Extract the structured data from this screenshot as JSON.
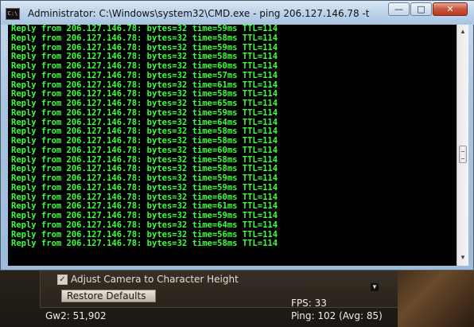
{
  "window": {
    "title": "Administrator: C:\\Windows\\system32\\CMD.exe - ping  206.127.146.78 -t",
    "icon_label": "C:\\",
    "minimize_label": "—",
    "maximize_label": "□",
    "close_label": "✕"
  },
  "console": {
    "lines": [
      "Reply from 206.127.146.78: bytes=32 time=59ms TTL=114",
      "Reply from 206.127.146.78: bytes=32 time=58ms TTL=114",
      "Reply from 206.127.146.78: bytes=32 time=59ms TTL=114",
      "Reply from 206.127.146.78: bytes=32 time=58ms TTL=114",
      "Reply from 206.127.146.78: bytes=32 time=60ms TTL=114",
      "Reply from 206.127.146.78: bytes=32 time=57ms TTL=114",
      "Reply from 206.127.146.78: bytes=32 time=61ms TTL=114",
      "Reply from 206.127.146.78: bytes=32 time=58ms TTL=114",
      "Reply from 206.127.146.78: bytes=32 time=65ms TTL=114",
      "Reply from 206.127.146.78: bytes=32 time=59ms TTL=114",
      "Reply from 206.127.146.78: bytes=32 time=64ms TTL=114",
      "Reply from 206.127.146.78: bytes=32 time=58ms TTL=114",
      "Reply from 206.127.146.78: bytes=32 time=58ms TTL=114",
      "Reply from 206.127.146.78: bytes=32 time=60ms TTL=114",
      "Reply from 206.127.146.78: bytes=32 time=58ms TTL=114",
      "Reply from 206.127.146.78: bytes=32 time=58ms TTL=114",
      "Reply from 206.127.146.78: bytes=32 time=59ms TTL=114",
      "Reply from 206.127.146.78: bytes=32 time=59ms TTL=114",
      "Reply from 206.127.146.78: bytes=32 time=60ms TTL=114",
      "Reply from 206.127.146.78: bytes=32 time=61ms TTL=114",
      "Reply from 206.127.146.78: bytes=32 time=59ms TTL=114",
      "Reply from 206.127.146.78: bytes=32 time=64ms TTL=114",
      "Reply from 206.127.146.78: bytes=32 time=56ms TTL=114",
      "Reply from 206.127.146.78: bytes=32 time=58ms TTL=114"
    ],
    "text_color": "#3cff3c",
    "background_color": "#000000"
  },
  "game_ui": {
    "adjust_camera_label": "Adjust Camera to Character Height",
    "adjust_camera_checked": true,
    "restore_defaults_label": "Restore Defaults",
    "gw2_label": "Gw2: 51,902",
    "fps_label": "FPS: 33",
    "ping_label": "Ping: 102 (Avg: 85)"
  },
  "icons": {
    "checkbox": "check-icon",
    "scroll_up": "chevron-up-icon",
    "scroll_down": "chevron-down-icon",
    "game_scroll": "chevron-down-icon"
  }
}
